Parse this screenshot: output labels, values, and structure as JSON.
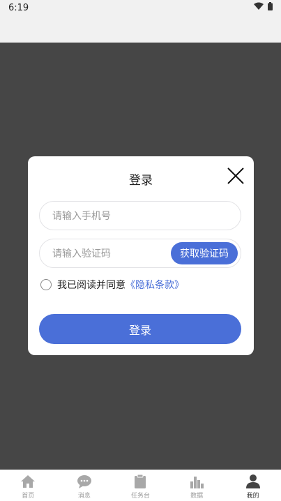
{
  "status_bar": {
    "time": "6:19"
  },
  "login_modal": {
    "title": "登录",
    "phone_placeholder": "请输入手机号",
    "code_placeholder": "请输入验证码",
    "get_code_label": "获取验证码",
    "agree_text": "我已阅读并同意",
    "privacy_link": "《隐私条款》",
    "login_label": "登录"
  },
  "tabs": [
    {
      "label": "首页",
      "icon": "home-icon"
    },
    {
      "label": "消息",
      "icon": "chat-icon"
    },
    {
      "label": "任务台",
      "icon": "clipboard-icon"
    },
    {
      "label": "数据",
      "icon": "bar-chart-icon"
    },
    {
      "label": "我的",
      "icon": "user-icon",
      "active": true
    }
  ],
  "colors": {
    "accent": "#4a6fd8",
    "overlay": "#464646"
  }
}
